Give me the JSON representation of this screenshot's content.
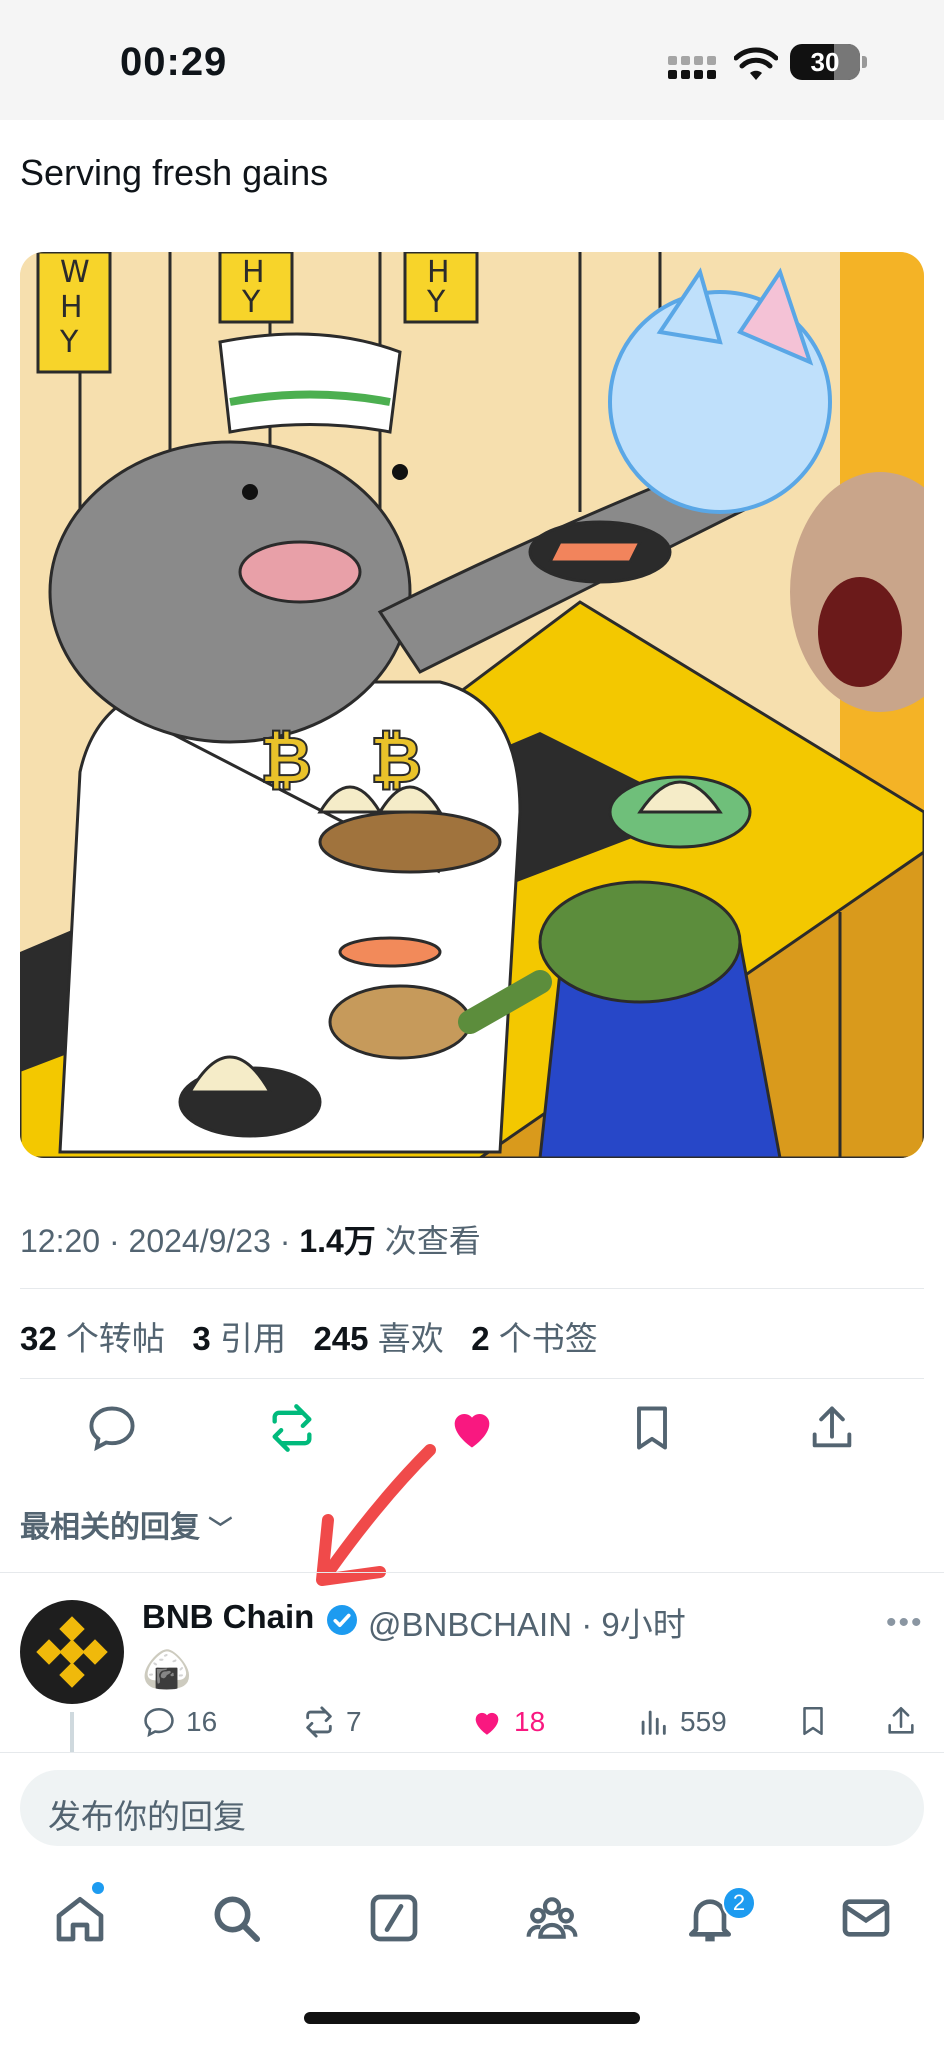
{
  "status_bar": {
    "time": "00:29",
    "battery": "30"
  },
  "tweet": {
    "text": "Serving fresh gains",
    "time": "12:20",
    "date": "2024/9/23",
    "views_count": "1.4万",
    "views_label": "次查看",
    "stats": {
      "retweets": "32",
      "retweets_label": "个转帖",
      "quotes": "3",
      "quotes_label": "引用",
      "likes": "245",
      "likes_label": "喜欢",
      "bookmarks": "2",
      "bookmarks_label": "个书签"
    },
    "image_sign_text": [
      "W",
      "H",
      "Y"
    ]
  },
  "replies": {
    "sort_label": "最相关的回复",
    "items": [
      {
        "name": "BNB Chain",
        "handle": "@BNBCHAIN",
        "age": "9小时",
        "content": "🍙",
        "replies": "16",
        "retweets": "7",
        "likes": "18",
        "views": "559"
      }
    ]
  },
  "composer": {
    "placeholder": "发布你的回复"
  },
  "tabbar": {
    "notification_count": "2"
  },
  "colors": {
    "accent": "#1d9bf0",
    "like": "#f91880",
    "retweet": "#00ba7c",
    "annotation_arrow": "#f04a4a"
  }
}
